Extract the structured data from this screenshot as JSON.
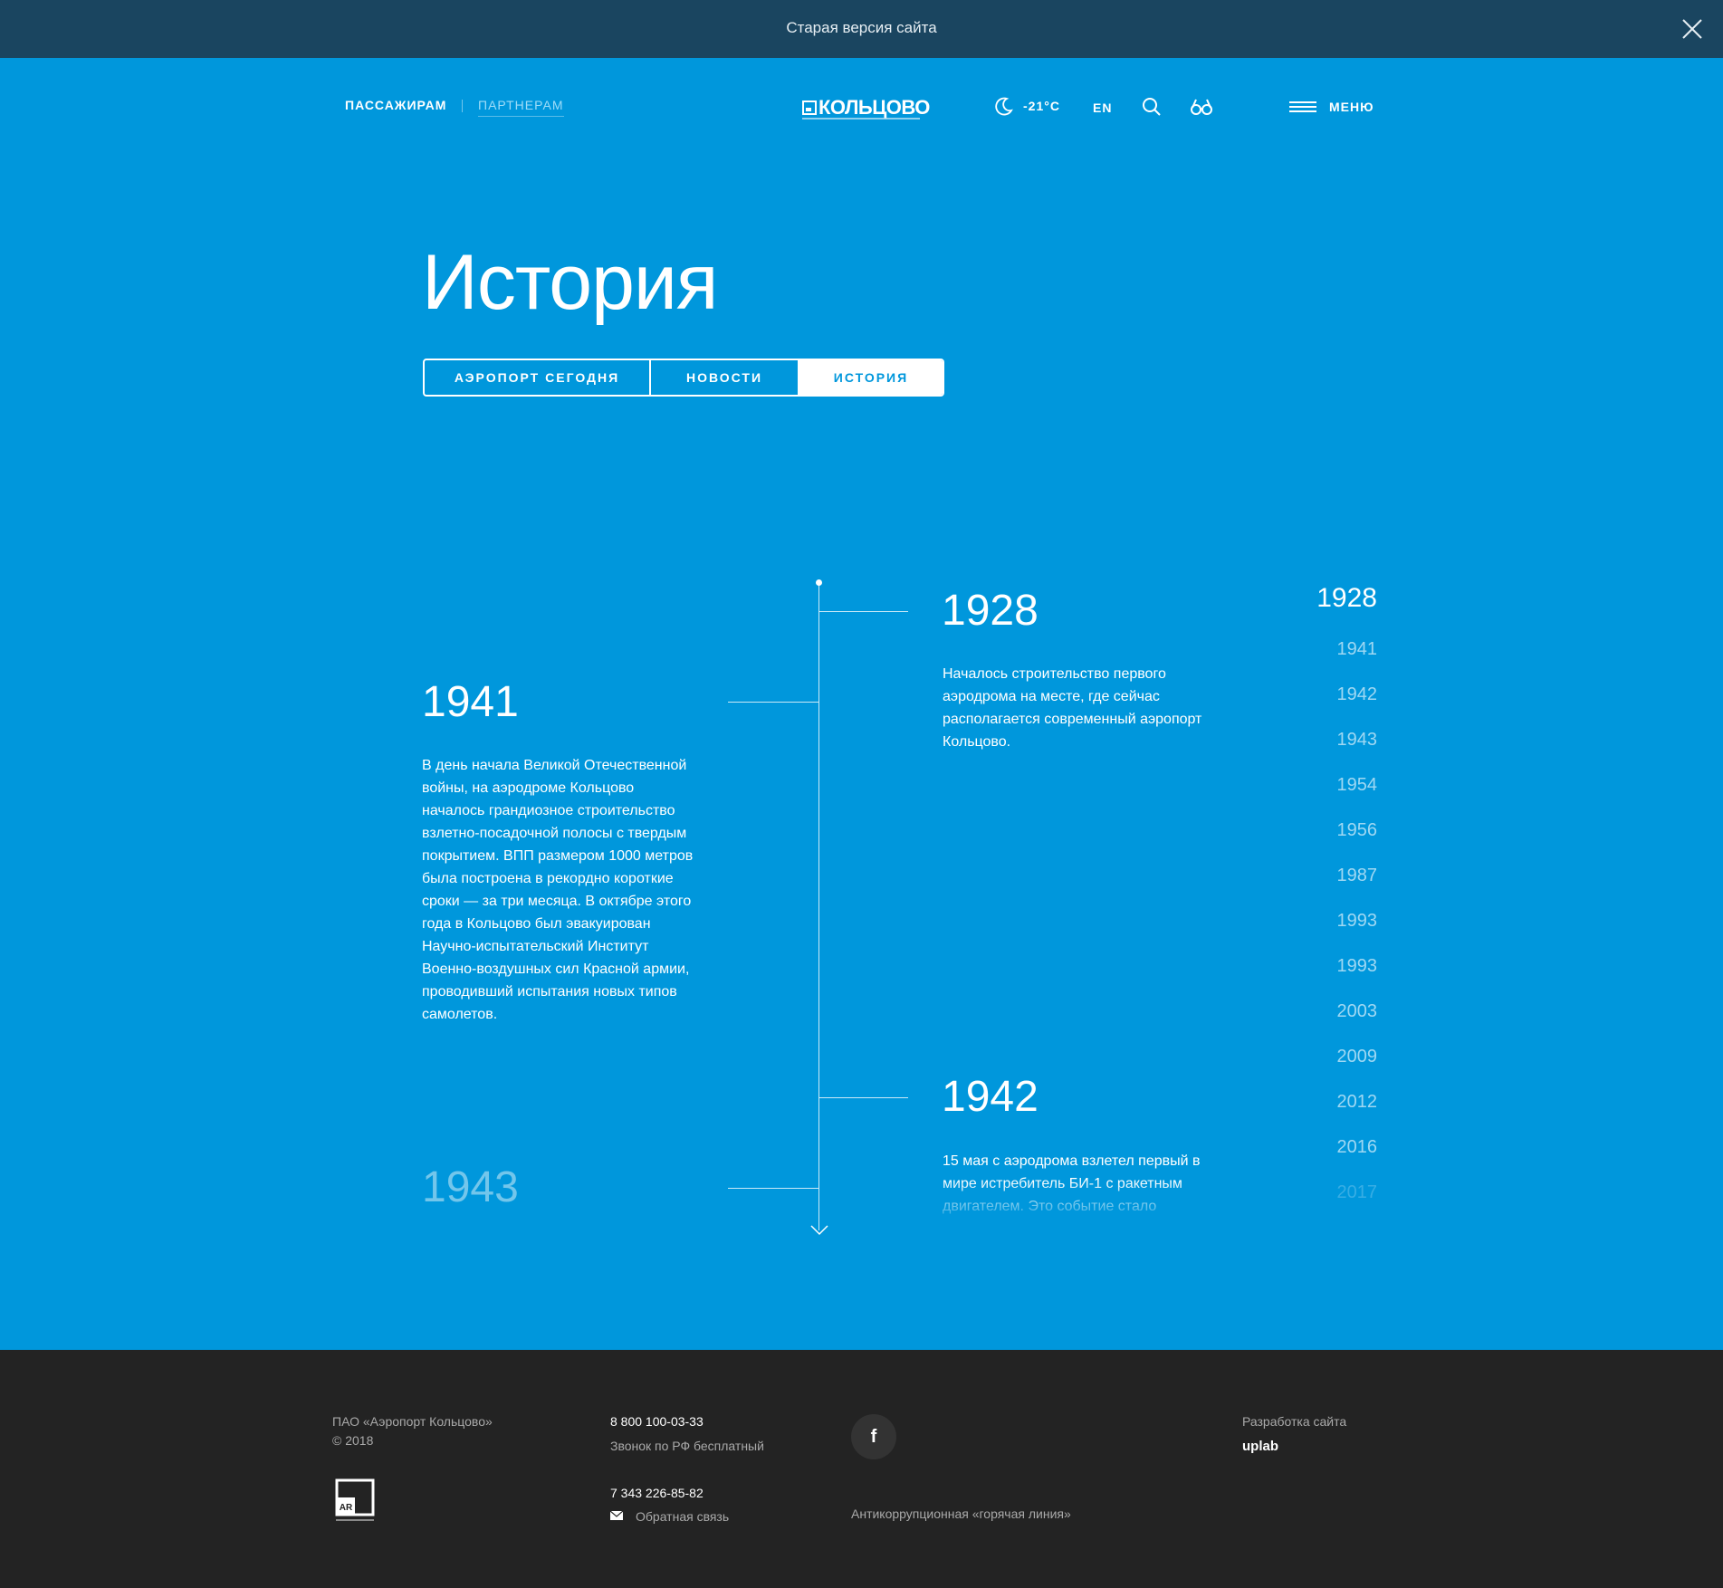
{
  "banner": {
    "text": "Старая версия сайта",
    "close_icon": "close-icon"
  },
  "header": {
    "nav": {
      "passengers": "ПАССАЖИРАМ",
      "partners": "ПАРТНЕРАМ"
    },
    "logo": "КОЛЬЦОВО",
    "weather": {
      "icon": "moon-icon",
      "temp": "-21°C"
    },
    "lang": "EN",
    "search_icon": "search-icon",
    "accessibility_icon": "glasses-icon",
    "menu": "МЕНЮ"
  },
  "page": {
    "title": "История"
  },
  "tabs": [
    {
      "label": "АЭРОПОРТ СЕГОДНЯ",
      "active": false
    },
    {
      "label": "НОВОСТИ",
      "active": false
    },
    {
      "label": "ИСТОРИЯ",
      "active": true
    }
  ],
  "timeline": {
    "events": [
      {
        "year": "1928",
        "side": "right",
        "text": "Началось строительство первого аэродрома на месте, где сейчас располагается современный аэропорт Кольцово."
      },
      {
        "year": "1941",
        "side": "left",
        "text": "В день начала Великой Отечественной войны, на аэродроме Кольцово началось грандиозное строительство взлетно-посадочной полосы с твердым покрытием. ВПП размером 1000 метров была построена в рекордно короткие сроки — за три месяца. В октябре этого года в Кольцово был эвакуирован Научно-испытательский Институт Военно-воздушных сил Красной армии, проводивший испытания новых типов самолетов."
      },
      {
        "year": "1942",
        "side": "right",
        "text": "15 мая с аэродрома взлетел первый в мире истребитель БИ-1 с ракетным двигателем. Это событие стало"
      },
      {
        "year": "1943",
        "side": "left",
        "text": ""
      }
    ],
    "year_index": [
      "1928",
      "1941",
      "1942",
      "1943",
      "1954",
      "1956",
      "1987",
      "1993",
      "1993",
      "2003",
      "2009",
      "2012",
      "2016",
      "2017"
    ],
    "active_year": "1928"
  },
  "footer": {
    "company": "ПАО «Аэропорт Кольцово»",
    "copyright": "© 2018",
    "phone1": "8 800 100-03-33",
    "phone1_note": "Звонок по РФ бесплатный",
    "phone2": "7 343 226-85-82",
    "feedback": "Обратная связь",
    "social": "f",
    "hotline": "Антикоррупционная «горячая линия»",
    "dev_label": "Разработка сайта",
    "dev_name": "uplab",
    "ar_logo": "AR"
  },
  "colors": {
    "primary": "#0097dc",
    "banner": "#1a4560",
    "footer": "#232323",
    "inactive_year": "#9fd8f3"
  }
}
